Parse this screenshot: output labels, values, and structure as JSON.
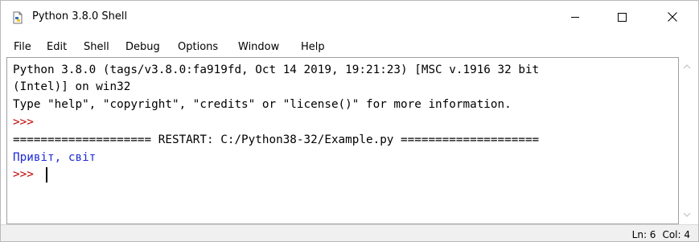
{
  "window": {
    "title": "Python 3.8.0 Shell",
    "app_icon": "python-file-icon",
    "controls": {
      "minimize": "minimize-icon",
      "maximize": "maximize-icon",
      "close": "close-icon"
    }
  },
  "menubar": {
    "items": [
      "File",
      "Edit",
      "Shell",
      "Debug",
      "Options",
      "Window",
      "Help"
    ]
  },
  "shell": {
    "lines": [
      {
        "kind": "normal",
        "text": "Python 3.8.0 (tags/v3.8.0:fa919fd, Oct 14 2019, 19:21:23) [MSC v.1916 32 bit"
      },
      {
        "kind": "normal",
        "text": "(Intel)] on win32"
      },
      {
        "kind": "normal",
        "text": "Type \"help\", \"copyright\", \"credits\" or \"license()\" for more information."
      },
      {
        "kind": "prompt",
        "text": ">>>"
      },
      {
        "kind": "normal",
        "text": "==================== RESTART: C:/Python38-32/Example.py ===================="
      },
      {
        "kind": "output",
        "text": "Привіт, світ"
      },
      {
        "kind": "prompt",
        "text": ">>> "
      }
    ],
    "colors": {
      "prompt": "#c00000",
      "output": "#1f2bd6",
      "text": "#000000"
    }
  },
  "scrollbar": {
    "up": "scroll-up-arrow-icon",
    "down": "scroll-down-arrow-icon"
  },
  "status": {
    "ln": "Ln: 6",
    "col": "Col: 4"
  }
}
